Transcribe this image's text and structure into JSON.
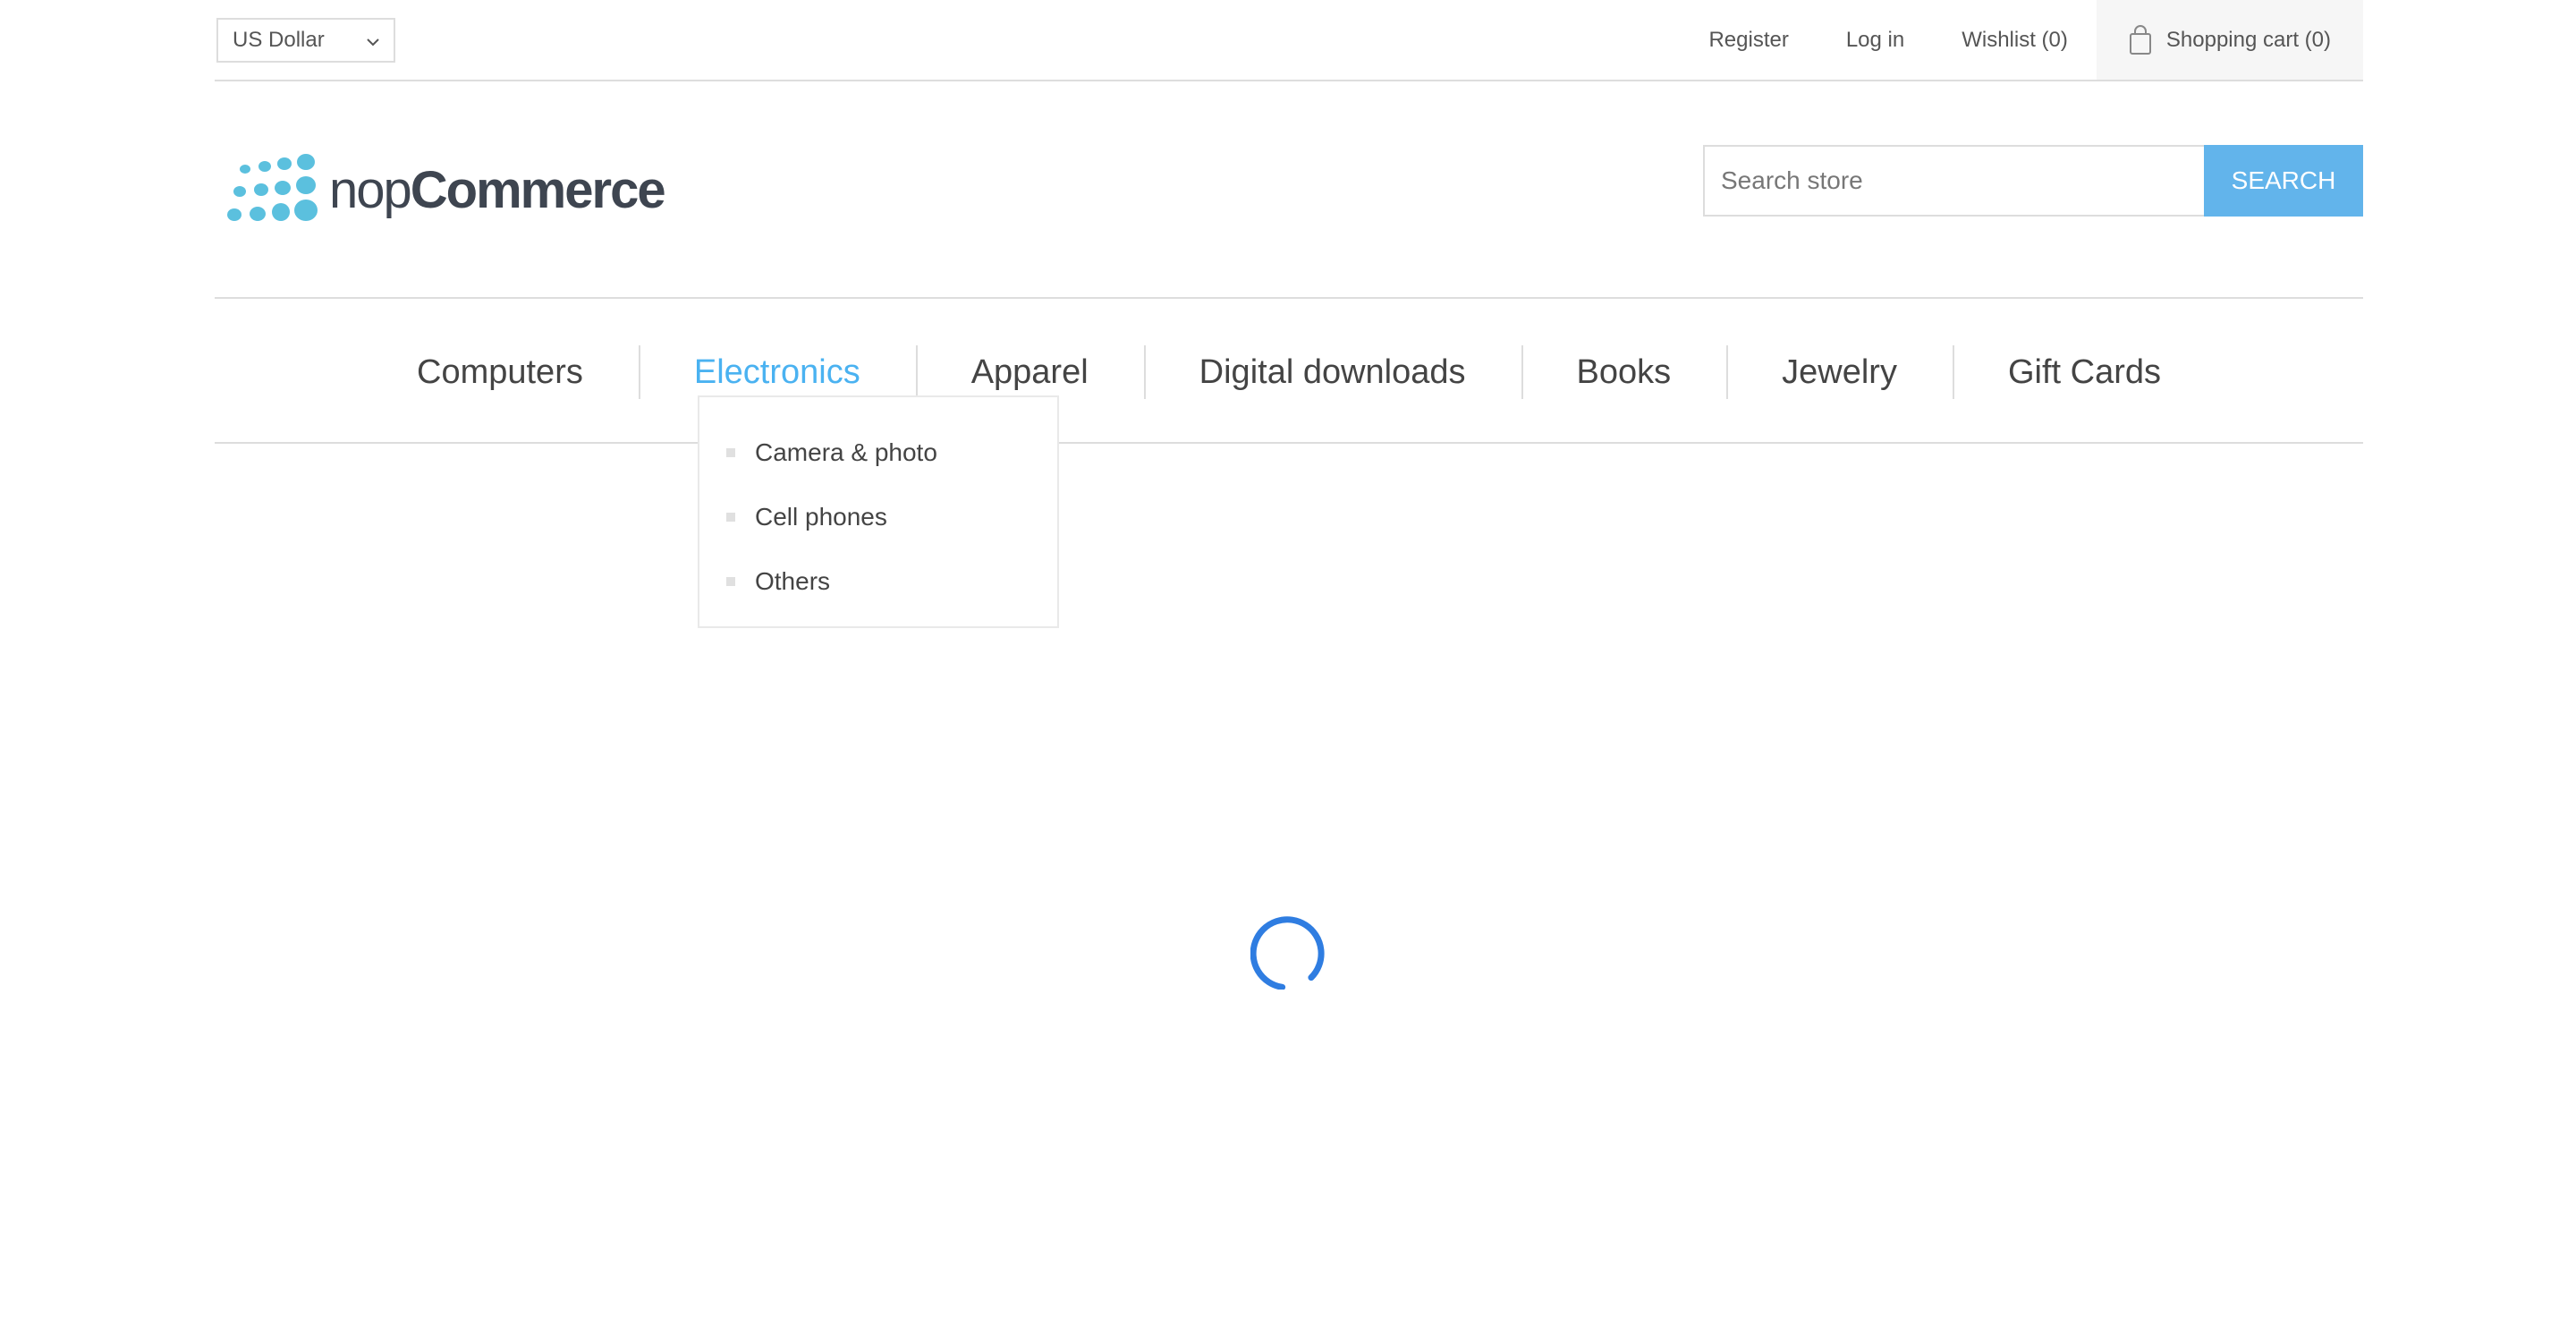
{
  "header": {
    "currency": {
      "selected": "US Dollar"
    },
    "links": {
      "register": "Register",
      "login": "Log in",
      "wishlist": "Wishlist (0)",
      "cart": "Shopping cart (0)"
    }
  },
  "logo": {
    "part1": "nop",
    "part2": "Commerce"
  },
  "search": {
    "placeholder": "Search store",
    "button": "SEARCH"
  },
  "menu": {
    "items": [
      "Computers",
      "Electronics",
      "Apparel",
      "Digital downloads",
      "Books",
      "Jewelry",
      "Gift Cards"
    ],
    "active": "Electronics",
    "submenu": [
      "Camera & photo",
      "Cell phones",
      "Others"
    ]
  },
  "colors": {
    "accent": "#4ab2f1",
    "search_button": "#62b4eb",
    "logo_dots": "#5bc0de",
    "spinner": "#2f7de1"
  },
  "icons": {
    "cart": "shopping-bag-icon",
    "currency_dropdown": "chevron-down-icon",
    "loading": "spinner-icon"
  }
}
